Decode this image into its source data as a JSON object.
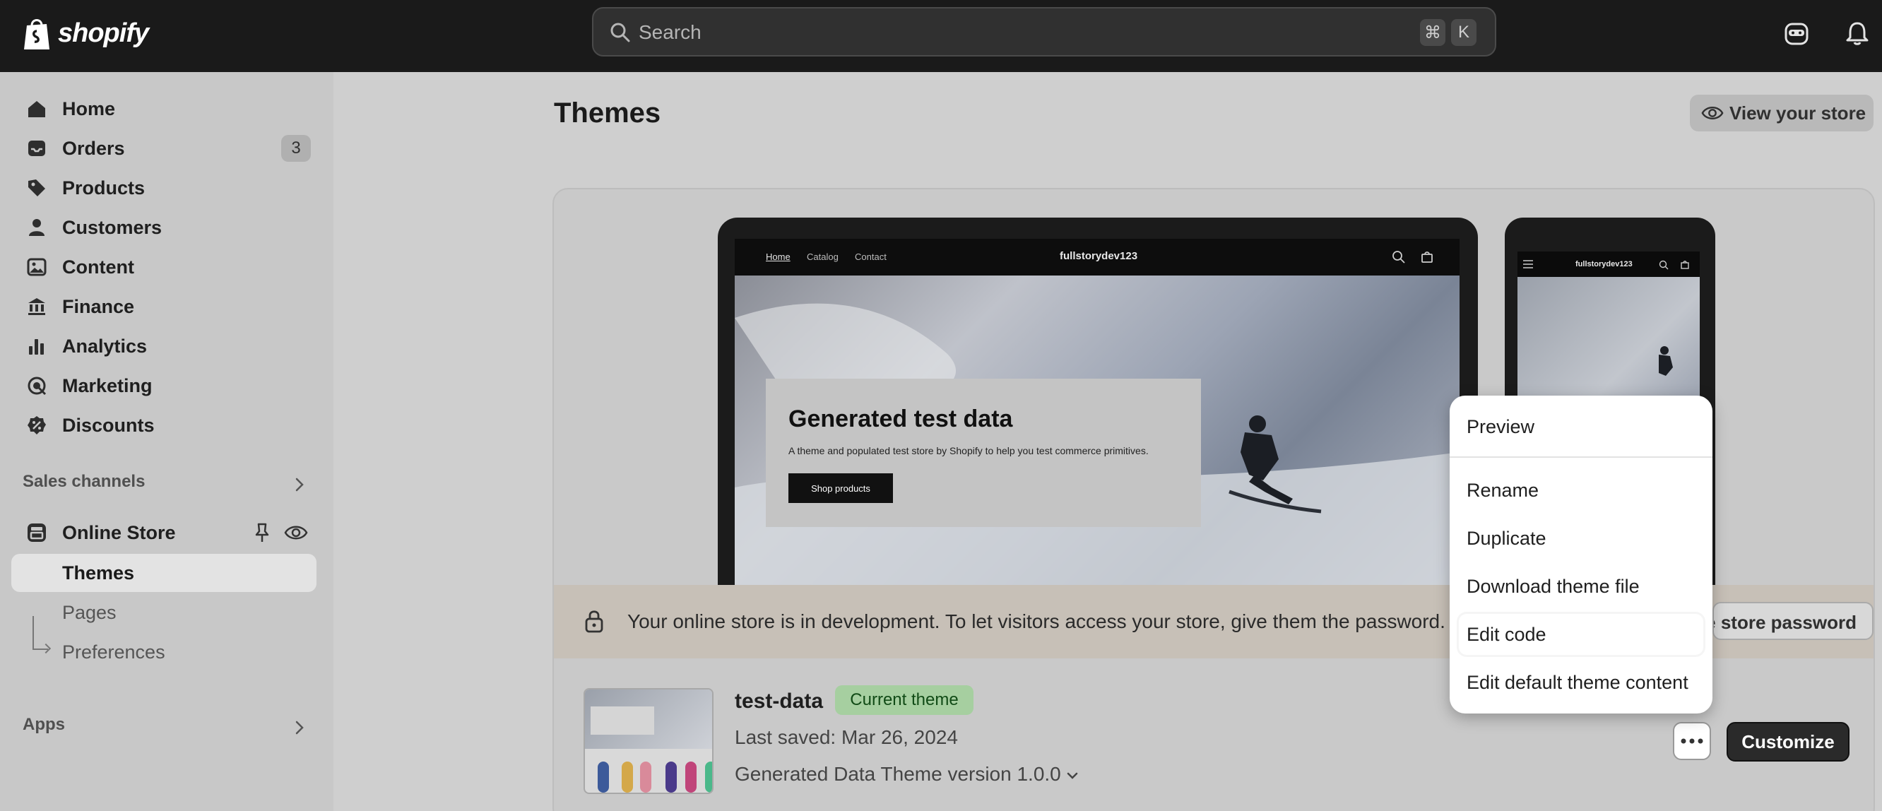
{
  "brand": {
    "name": "shopify"
  },
  "search": {
    "placeholder": "Search",
    "shortcut_cmd": "⌘",
    "shortcut_key": "K"
  },
  "sidebar": {
    "items": [
      {
        "label": "Home",
        "icon": "home-icon"
      },
      {
        "label": "Orders",
        "icon": "inbox-icon",
        "badge": "3"
      },
      {
        "label": "Products",
        "icon": "tag-icon"
      },
      {
        "label": "Customers",
        "icon": "person-icon"
      },
      {
        "label": "Content",
        "icon": "image-icon"
      },
      {
        "label": "Finance",
        "icon": "bank-icon"
      },
      {
        "label": "Analytics",
        "icon": "bar-chart-icon"
      },
      {
        "label": "Marketing",
        "icon": "target-icon"
      },
      {
        "label": "Discounts",
        "icon": "discount-icon"
      }
    ],
    "sales_channels_title": "Sales channels",
    "online_store": {
      "label": "Online Store"
    },
    "sub_items": [
      {
        "label": "Themes"
      },
      {
        "label": "Pages"
      },
      {
        "label": "Preferences"
      }
    ],
    "apps_title": "Apps"
  },
  "main": {
    "title": "Themes",
    "view_store_label": "View your store"
  },
  "preview": {
    "nav_links": [
      "Home",
      "Catalog",
      "Contact"
    ],
    "store_name": "fullstorydev123",
    "hero_title": "Generated test data",
    "hero_subtitle": "A theme and populated test store by Shopify to help you test commerce primitives.",
    "hero_button": "Shop products"
  },
  "banner": {
    "text": "Your online store is in development. To let visitors access your store, give them the password.",
    "password_button": "Share store password"
  },
  "theme": {
    "name": "test-data",
    "badge": "Current theme",
    "last_saved": "Last saved: Mar 26, 2024",
    "version": "Generated Data Theme version 1.0.0",
    "customize_label": "Customize"
  },
  "menu": {
    "items": [
      {
        "label": "Preview"
      },
      {
        "label": "Rename"
      },
      {
        "label": "Duplicate"
      },
      {
        "label": "Download theme file"
      },
      {
        "label": "Edit code"
      },
      {
        "label": "Edit default theme content"
      }
    ]
  },
  "colors": {
    "topbar": "#1a1a1a",
    "current_badge_bg": "#a6cfa0",
    "banner_bg": "#c7c0b7",
    "primary_button": "#2a2a2a"
  }
}
